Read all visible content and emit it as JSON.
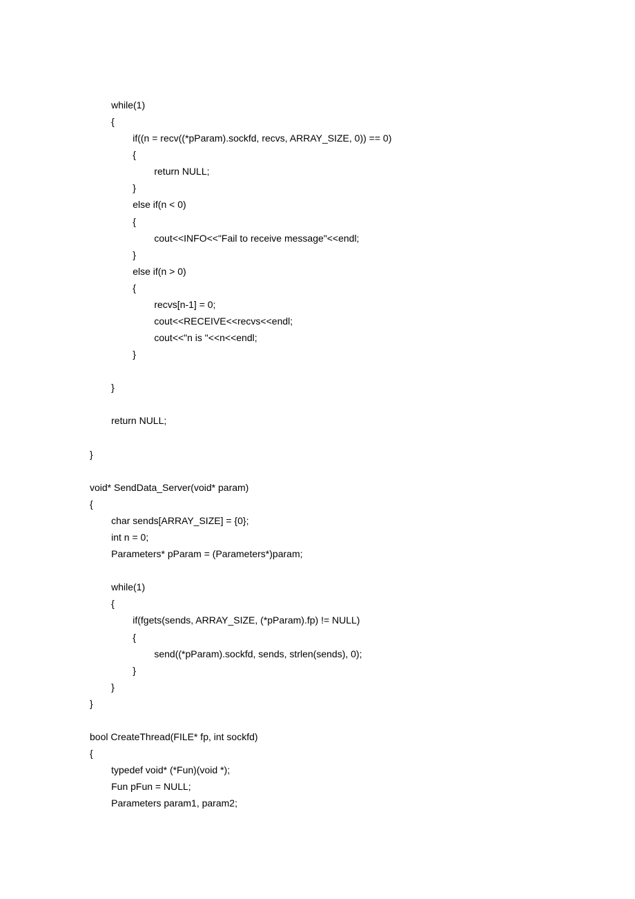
{
  "code": {
    "lines": [
      "        while(1)",
      "        {",
      "                if((n = recv((*pParam).sockfd, recvs, ARRAY_SIZE, 0)) == 0)",
      "                {",
      "                        return NULL;",
      "                }",
      "                else if(n < 0)",
      "                {",
      "                        cout<<INFO<<\"Fail to receive message\"<<endl;",
      "                }",
      "                else if(n > 0)",
      "                {",
      "                        recvs[n-1] = 0;",
      "                        cout<<RECEIVE<<recvs<<endl;",
      "                        cout<<\"n is \"<<n<<endl;",
      "                }",
      "",
      "        }",
      "",
      "        return NULL;",
      "",
      "}",
      "",
      "void* SendData_Server(void* param)",
      "{",
      "        char sends[ARRAY_SIZE] = {0};",
      "        int n = 0;",
      "        Parameters* pParam = (Parameters*)param;",
      "",
      "        while(1)",
      "        {",
      "                if(fgets(sends, ARRAY_SIZE, (*pParam).fp) != NULL)",
      "                {",
      "                        send((*pParam).sockfd, sends, strlen(sends), 0);",
      "                }",
      "        }",
      "}",
      "",
      "bool CreateThread(FILE* fp, int sockfd)",
      "{",
      "        typedef void* (*Fun)(void *);",
      "        Fun pFun = NULL;",
      "        Parameters param1, param2;"
    ]
  }
}
